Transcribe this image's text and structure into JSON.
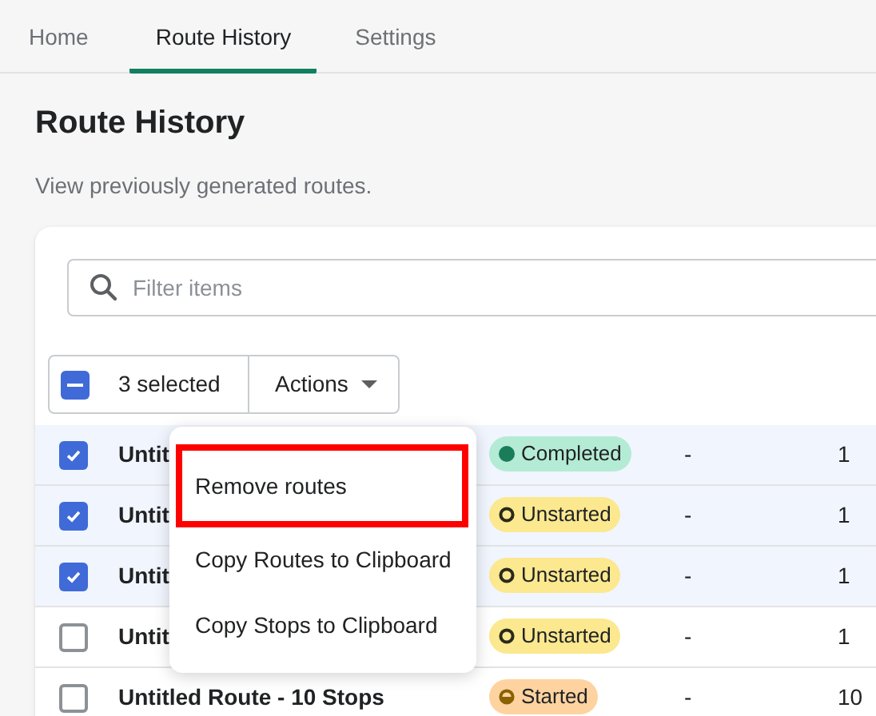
{
  "tabs": [
    {
      "label": "Home",
      "selected": false
    },
    {
      "label": "Route History",
      "selected": true
    },
    {
      "label": "Settings",
      "selected": false
    }
  ],
  "page": {
    "title": "Route History",
    "subtitle": "View previously generated routes."
  },
  "search": {
    "placeholder": "Filter items"
  },
  "bulk_actions": {
    "checked": true,
    "indeterminate": true,
    "count": "3 selected",
    "actions_label": "Actions"
  },
  "rows": [
    {
      "selected": true,
      "name": "Untit",
      "status": {
        "kind": "completed",
        "label": "Completed"
      },
      "column_4": "-",
      "column_5": "1"
    },
    {
      "selected": true,
      "name": "Untit",
      "status": {
        "kind": "unstarted",
        "label": "Unstarted"
      },
      "column_4": "-",
      "column_5": "1"
    },
    {
      "selected": true,
      "name": "Untit",
      "status": {
        "kind": "unstarted",
        "label": "Unstarted"
      },
      "column_4": "-",
      "column_5": "1"
    },
    {
      "selected": false,
      "name": "Untit",
      "status": {
        "kind": "unstarted",
        "label": "Unstarted"
      },
      "column_4": "-",
      "column_5": "1"
    },
    {
      "selected": false,
      "name": "Untitled Route - 10 Stops",
      "status": {
        "kind": "started",
        "label": "Started"
      },
      "column_4": "-",
      "column_5": "10"
    }
  ],
  "actions_menu": [
    {
      "label": "Remove routes",
      "highlighted": true
    },
    {
      "label": "Copy Routes to Clipboard",
      "highlighted": false
    },
    {
      "label": "Copy Stops to Clipboard",
      "highlighted": false
    }
  ]
}
